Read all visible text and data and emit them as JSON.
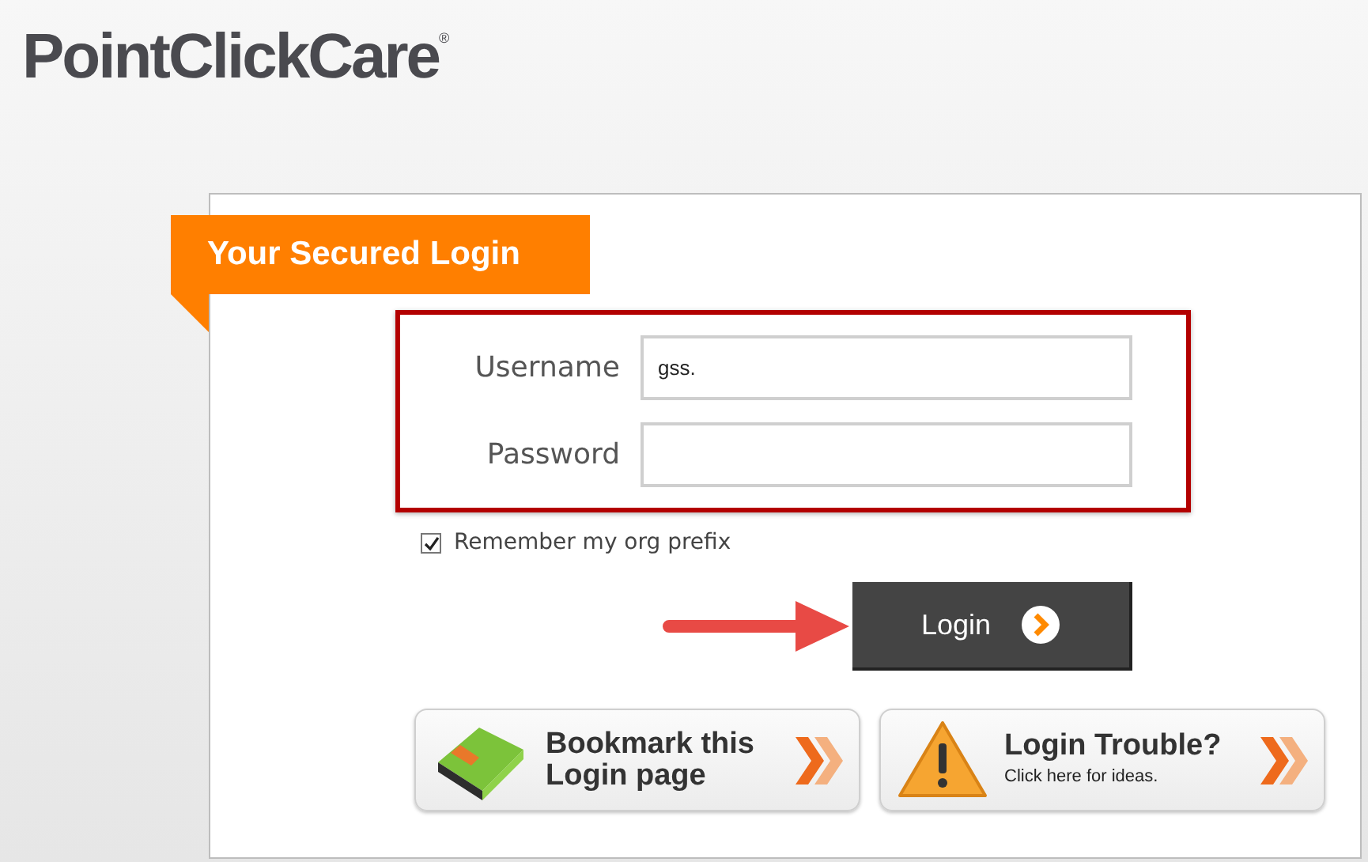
{
  "logo": {
    "text": "PointClickCare",
    "mark": "®"
  },
  "login_panel": {
    "title": "Your Secured Login",
    "fields": [
      {
        "label": "Username",
        "value": "gss."
      },
      {
        "label": "Password"
      }
    ],
    "remember": {
      "label": "Remember my org prefix",
      "checked": true
    },
    "submit": {
      "label": "Login"
    },
    "links": [
      {
        "kind": "bookmark",
        "lines": [
          "Bookmark this",
          "Login page"
        ]
      },
      {
        "kind": "trouble",
        "title": "Login Trouble?",
        "subtitle": "Click here for ideas."
      }
    ]
  }
}
